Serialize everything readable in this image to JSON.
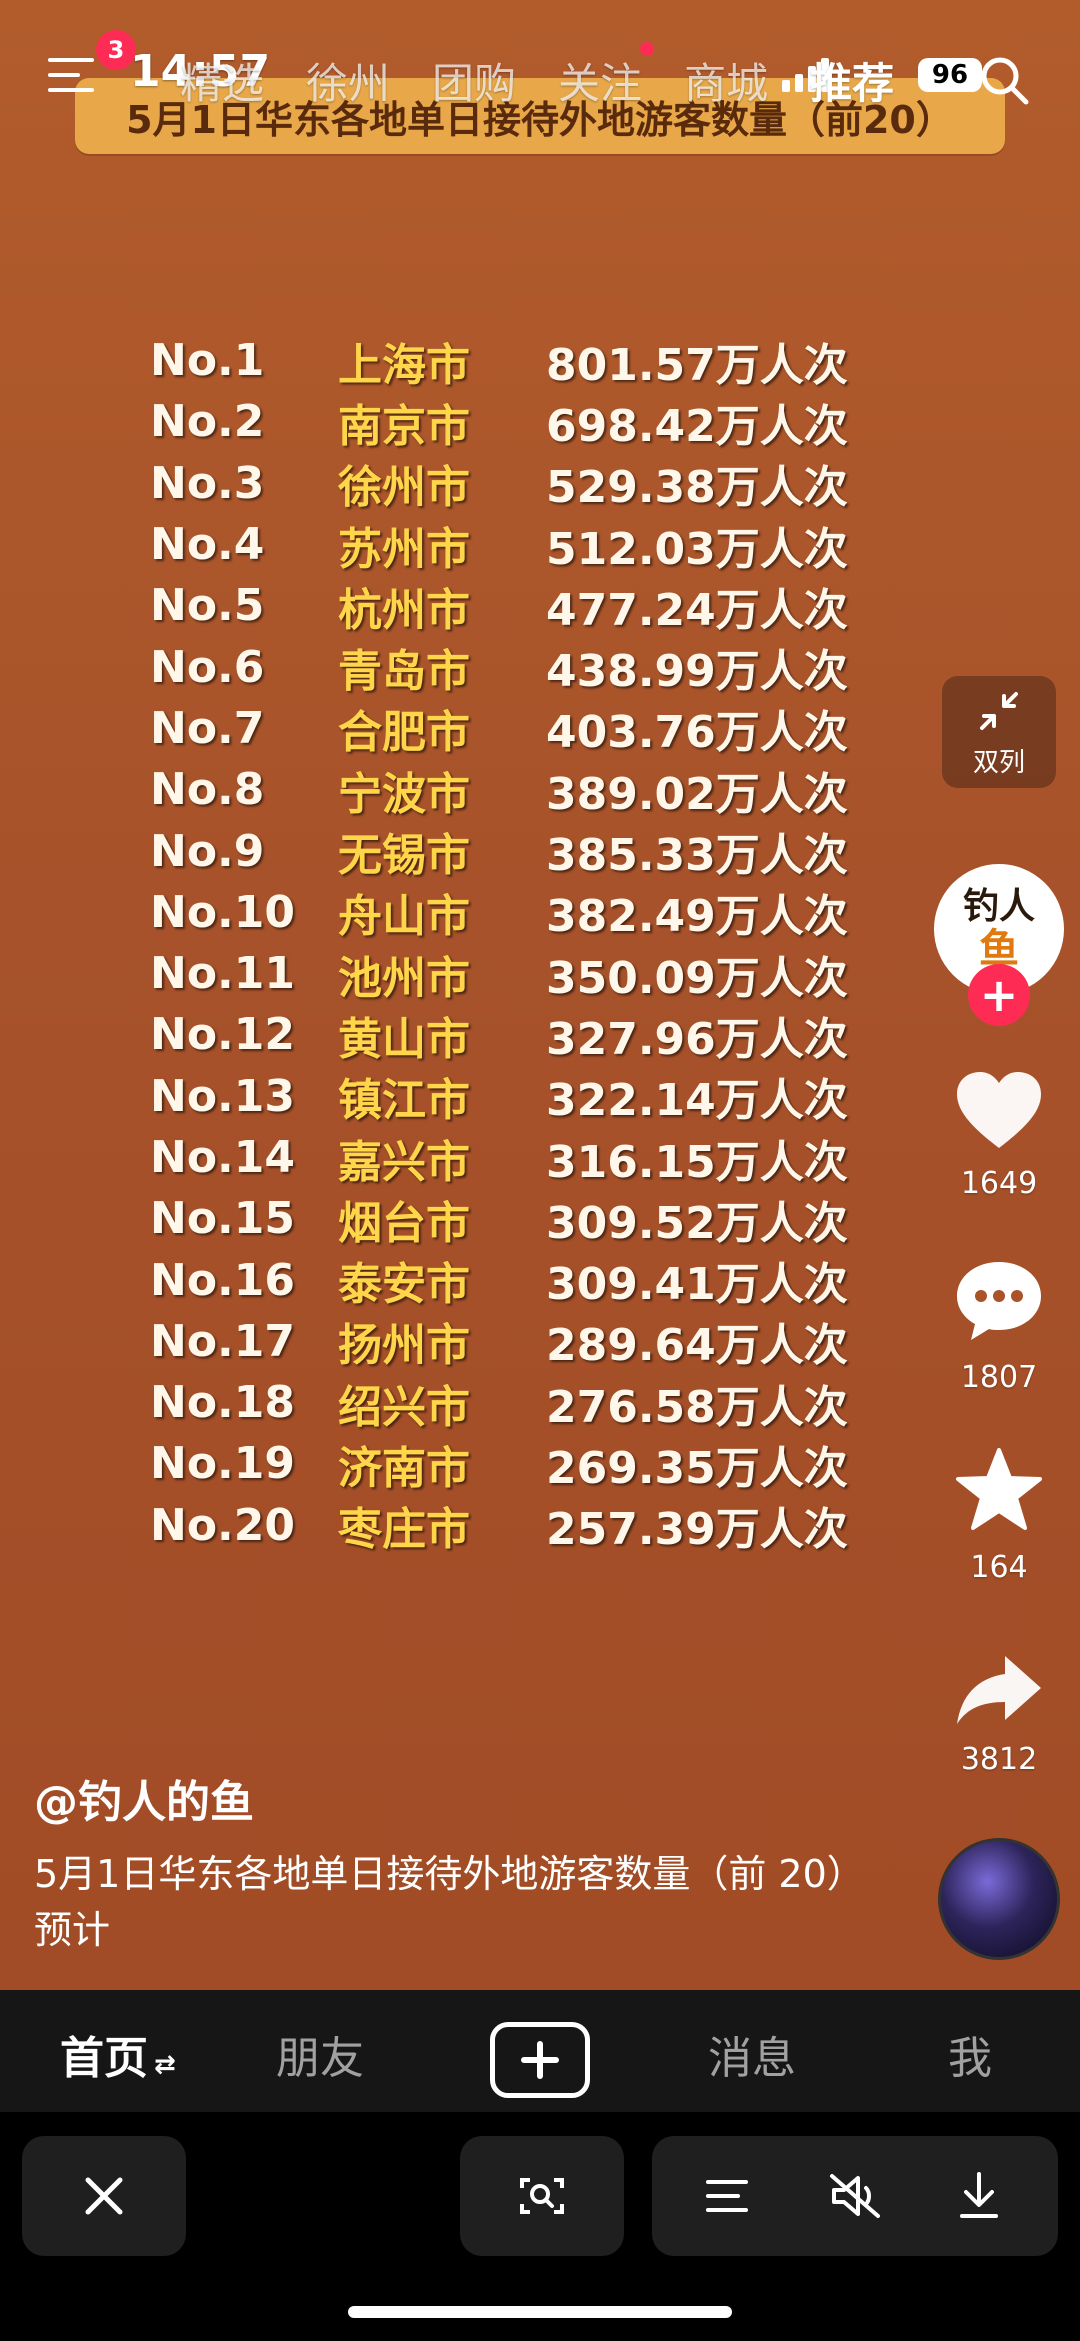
{
  "status_bar": {
    "time": "14:57",
    "battery": "96"
  },
  "top_nav": {
    "badge_count": "3",
    "tabs": [
      {
        "label": "精选",
        "active": false,
        "dot": false
      },
      {
        "label": "徐州",
        "active": false,
        "dot": false
      },
      {
        "label": "团购",
        "active": false,
        "dot": false
      },
      {
        "label": "关注",
        "active": false,
        "dot": true
      },
      {
        "label": "商城",
        "active": false,
        "dot": false
      },
      {
        "label": "推荐",
        "active": true,
        "dot": false
      }
    ]
  },
  "video": {
    "banner_title": "5月1日华东各地单日接待外地游客数量（前20）",
    "ranking": [
      {
        "no": "No.1",
        "city": "上海市",
        "value": "801.57万人次"
      },
      {
        "no": "No.2",
        "city": "南京市",
        "value": "698.42万人次"
      },
      {
        "no": "No.3",
        "city": "徐州市",
        "value": "529.38万人次"
      },
      {
        "no": "No.4",
        "city": "苏州市",
        "value": "512.03万人次"
      },
      {
        "no": "No.5",
        "city": "杭州市",
        "value": "477.24万人次"
      },
      {
        "no": "No.6",
        "city": "青岛市",
        "value": "438.99万人次"
      },
      {
        "no": "No.7",
        "city": "合肥市",
        "value": "403.76万人次"
      },
      {
        "no": "No.8",
        "city": "宁波市",
        "value": "389.02万人次"
      },
      {
        "no": "No.9",
        "city": "无锡市",
        "value": "385.33万人次"
      },
      {
        "no": "No.10",
        "city": "舟山市",
        "value": "382.49万人次"
      },
      {
        "no": "No.11",
        "city": "池州市",
        "value": "350.09万人次"
      },
      {
        "no": "No.12",
        "city": "黄山市",
        "value": "327.96万人次"
      },
      {
        "no": "No.13",
        "city": "镇江市",
        "value": "322.14万人次"
      },
      {
        "no": "No.14",
        "city": "嘉兴市",
        "value": "316.15万人次"
      },
      {
        "no": "No.15",
        "city": "烟台市",
        "value": "309.52万人次"
      },
      {
        "no": "No.16",
        "city": "泰安市",
        "value": "309.41万人次"
      },
      {
        "no": "No.17",
        "city": "扬州市",
        "value": "289.64万人次"
      },
      {
        "no": "No.18",
        "city": "绍兴市",
        "value": "276.58万人次"
      },
      {
        "no": "No.19",
        "city": "济南市",
        "value": "269.35万人次"
      },
      {
        "no": "No.20",
        "city": "枣庄市",
        "value": "257.39万人次"
      }
    ]
  },
  "right_rail": {
    "dual_column_label": "双列",
    "avatar_text_1": "钓人",
    "avatar_text_2": "鱼",
    "likes": "1649",
    "comments": "1807",
    "favorites": "164",
    "shares": "3812"
  },
  "caption": {
    "author": "@钓人的鱼",
    "description": "5月1日华东各地单日接待外地游客数量（前 20）预计"
  },
  "bottom_tabs": {
    "home": "首页",
    "friends": "朋友",
    "messages": "消息",
    "me": "我"
  },
  "colors": {
    "accent": "#fe2c55",
    "banner": "#e8a84a",
    "city": "#ffd54a"
  }
}
